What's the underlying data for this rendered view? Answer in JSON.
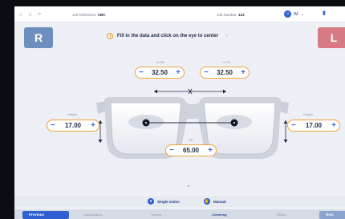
{
  "topbar": {
    "ref_label": "Job Reference",
    "ref_value": "ABC",
    "sp_label": "Job Number",
    "sp_value": "123",
    "user_initials": "IM",
    "user_name": "IM"
  },
  "tabs": {
    "right": "R",
    "left": "L"
  },
  "instruction": "Fill in the data and click on the eye to center",
  "fields": {
    "half_pd_right": {
      "label": "½ PD",
      "value": "32.50"
    },
    "half_pd_left": {
      "label": "½ PD",
      "value": "32.50"
    },
    "height_right": {
      "label": "Height",
      "value": "17.00"
    },
    "height_left": {
      "label": "Height",
      "value": "17.00"
    },
    "pd": {
      "label": "PD",
      "value": "65.00"
    }
  },
  "stepper": {
    "minus": "−",
    "plus": "+"
  },
  "options": {
    "single_vision": "Single vision",
    "manual": "Manual"
  },
  "steps": {
    "previous": "Previous",
    "items": [
      "Configuration",
      "Tracing",
      "Centering",
      "Fitting"
    ],
    "active": "Centering",
    "next": "Next"
  },
  "colors": {
    "accent": "#2f5fd0",
    "right": "#6d8fbf",
    "left": "#d77a84",
    "field_border": "#f1a23a"
  }
}
